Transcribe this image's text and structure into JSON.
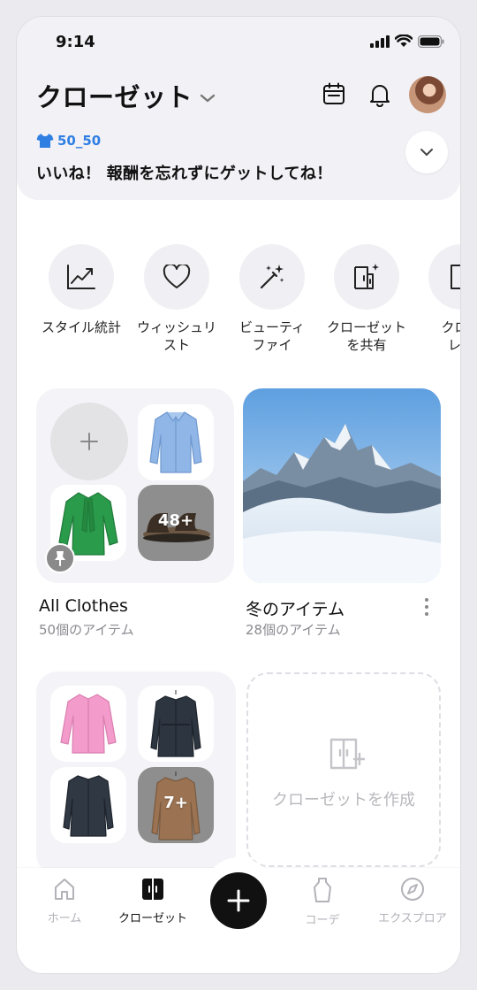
{
  "status_bar": {
    "time": "9:14"
  },
  "header": {
    "title": "クローゼット",
    "user_tag": "50_50",
    "reward_message": "いいね！ 報酬を忘れずにゲットしてね！"
  },
  "actions": [
    {
      "icon": "chart-line-icon",
      "label": "スタイル統計"
    },
    {
      "icon": "heart-icon",
      "label": "ウィッシュリ\nスト"
    },
    {
      "icon": "magic-wand-icon",
      "label": "ビューティ\nファイ"
    },
    {
      "icon": "share-closet-icon",
      "label": "クローゼット\nを共有"
    },
    {
      "icon": "closet-review-icon",
      "label": "クロー\nレビ"
    }
  ],
  "collections": [
    {
      "title": "All Clothes",
      "count": "50個のアイテム",
      "more": "48+"
    },
    {
      "title": "冬のアイテム",
      "count": "28個のアイテム"
    },
    {
      "more": "7+"
    }
  ],
  "create_closet_label": "クローゼットを作成",
  "tabs": [
    {
      "icon": "home-icon",
      "label": "ホーム",
      "active": false
    },
    {
      "icon": "closet-icon",
      "label": "クローゼット",
      "active": true
    },
    {
      "icon": "outfit-icon",
      "label": "コーデ",
      "active": false
    },
    {
      "icon": "compass-icon",
      "label": "エクスプロア",
      "active": false
    }
  ],
  "colors": {
    "accent_blue": "#2f7fe3",
    "fab": "#111111",
    "tile_bg": "#f4f4f8"
  }
}
